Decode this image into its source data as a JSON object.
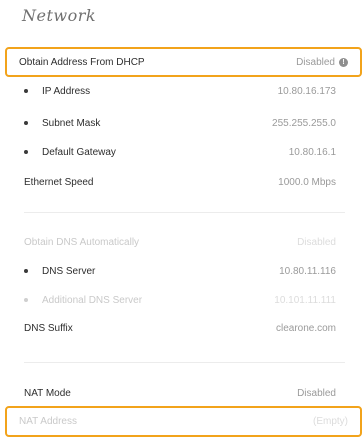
{
  "title": "Network",
  "dhcp": {
    "label": "Obtain Address From DHCP",
    "value": "Disabled",
    "icon": "info-icon"
  },
  "ip_address": {
    "label": "IP Address",
    "value": "10.80.16.173"
  },
  "subnet_mask": {
    "label": "Subnet Mask",
    "value": "255.255.255.0"
  },
  "default_gateway": {
    "label": "Default Gateway",
    "value": "10.80.16.1"
  },
  "ethernet_speed": {
    "label": "Ethernet Speed",
    "value": "1000.0 Mbps"
  },
  "dns_auto": {
    "label": "Obtain DNS Automatically",
    "value": "Disabled"
  },
  "dns_server": {
    "label": "DNS Server",
    "value": "10.80.11.116"
  },
  "additional_dns": {
    "label": "Additional DNS Server",
    "value": "10.101.11.111"
  },
  "dns_suffix": {
    "label": "DNS Suffix",
    "value": "clearone.com"
  },
  "nat_mode": {
    "label": "NAT Mode",
    "value": "Disabled"
  },
  "nat_address": {
    "label": "NAT Address",
    "value": "(Empty)"
  },
  "colors": {
    "highlight": "#f2a31b",
    "text": "#2d2d2d",
    "muted": "#9a9a9a"
  }
}
